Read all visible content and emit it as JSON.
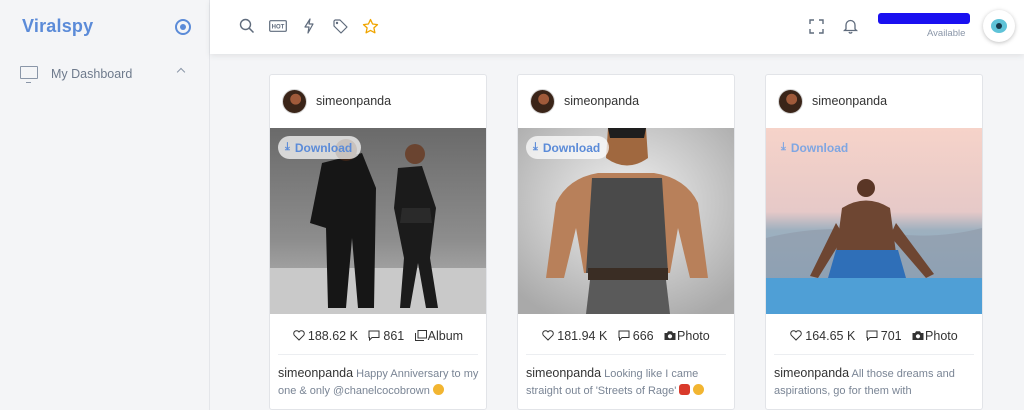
{
  "sidebar": {
    "brand": "Viralspy",
    "nav": [
      {
        "label": "My Dashboard",
        "icon": "monitor-icon"
      }
    ]
  },
  "header": {
    "icons": [
      "search-icon",
      "hot-icon",
      "lightning-icon",
      "tag-icon",
      "star-icon",
      "fullscreen-icon",
      "bell-icon"
    ],
    "hot_label": "HOT",
    "user_status": "Available"
  },
  "posts": [
    {
      "username": "simeonpanda",
      "download_label": "Download",
      "likes": "188.62 K",
      "comments": "861",
      "type": "Album",
      "caption_user": "simeonpanda",
      "caption_text": "Happy Anniversary to my one & only @chanelcocobrown"
    },
    {
      "username": "simeonpanda",
      "download_label": "Download",
      "likes": "181.94 K",
      "comments": "666",
      "type": "Photo",
      "caption_user": "simeonpanda",
      "caption_text": "Looking like I came straight out of 'Streets of Rage'"
    },
    {
      "username": "simeonpanda",
      "download_label": "Download",
      "likes": "164.65 K",
      "comments": "701",
      "type": "Photo",
      "caption_user": "simeonpanda",
      "caption_text": "All those dreams and aspirations, go for them with"
    }
  ],
  "colors": {
    "accent": "#5b8bd8",
    "star": "#f0a500",
    "redaction": "#1a10f0"
  }
}
